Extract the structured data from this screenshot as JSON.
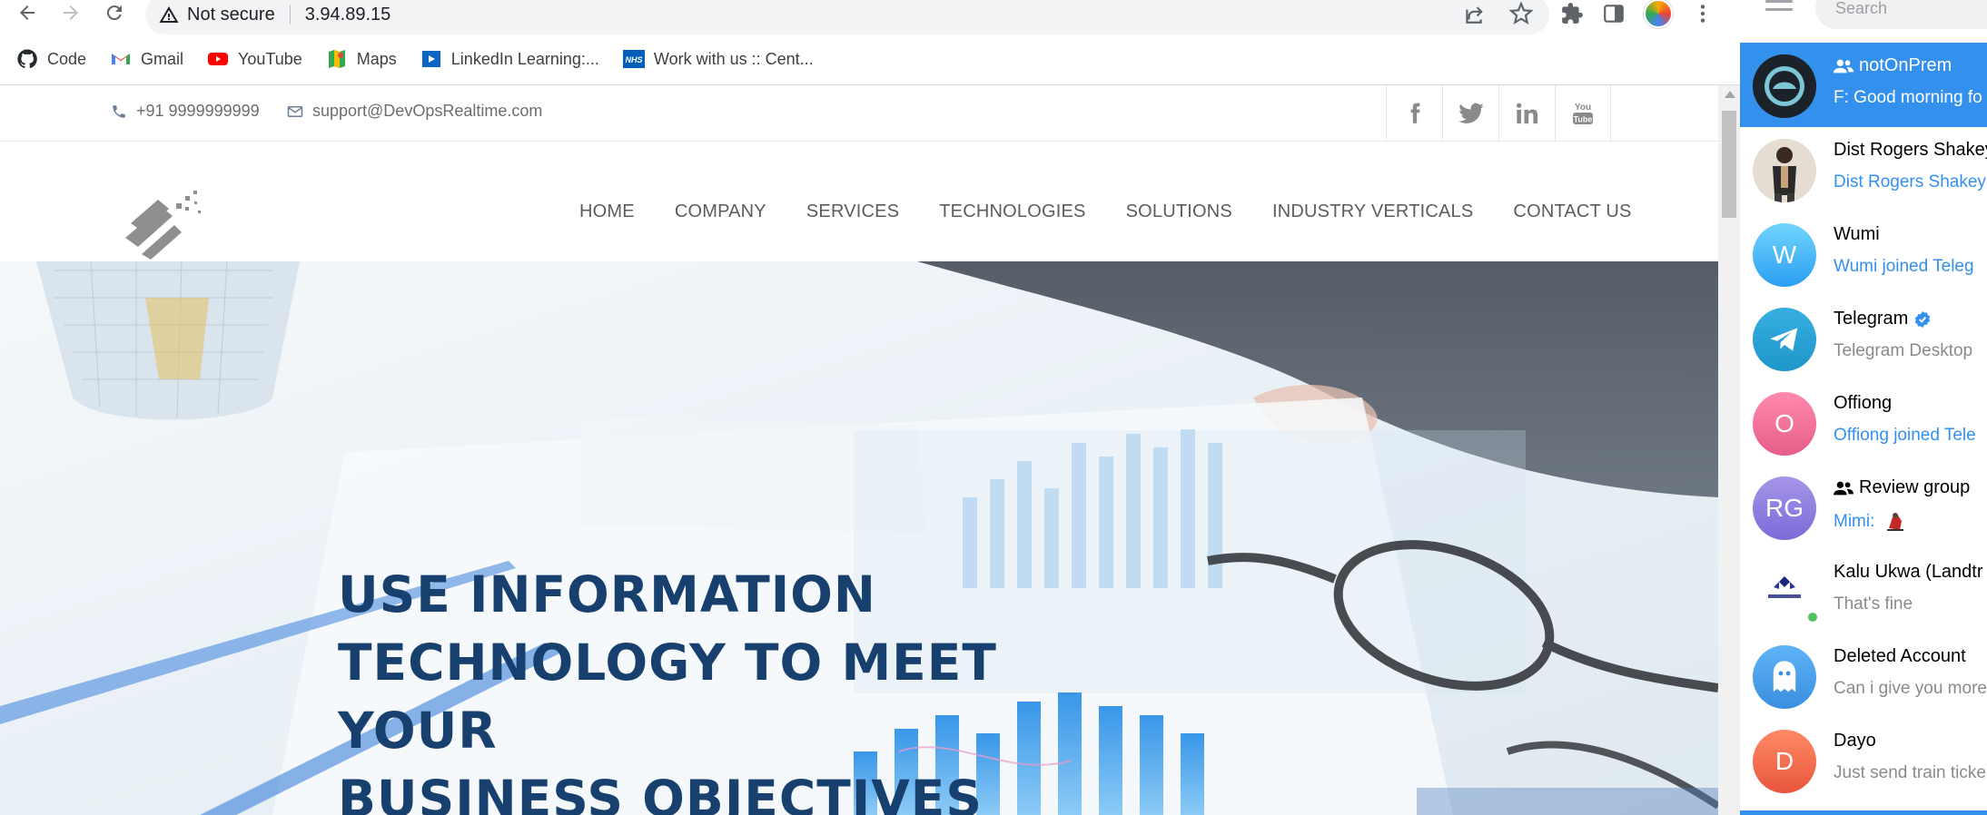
{
  "browser": {
    "omnibox": {
      "security_label": "Not secure",
      "url": "3.94.89.15"
    },
    "bookmarks": [
      {
        "label": "Code",
        "icon": "github-icon"
      },
      {
        "label": "Gmail",
        "icon": "gmail-icon"
      },
      {
        "label": "YouTube",
        "icon": "youtube-icon"
      },
      {
        "label": "Maps",
        "icon": "maps-icon"
      },
      {
        "label": "LinkedIn Learning:...",
        "icon": "linkedin-learning-icon"
      },
      {
        "label": "Work with us :: Cent...",
        "icon": "nhs-icon"
      }
    ]
  },
  "site": {
    "phone": "+91 9999999999",
    "email": "support@DevOpsRealtime.com",
    "socials": [
      "facebook",
      "twitter",
      "linkedin",
      "youtube"
    ],
    "menu": [
      "HOME",
      "COMPANY",
      "SERVICES",
      "TECHNOLOGIES",
      "SOLUTIONS",
      "INDUSTRY VERTICALS",
      "CONTACT US"
    ],
    "hero": {
      "line1": "USE INFORMATION",
      "line2": "TECHNOLOGY TO MEET YOUR",
      "line3": "BUSINESS OBJECTIVES"
    },
    "colors": {
      "hero_text": "#18406e",
      "menu_text": "#5c5c5c"
    }
  },
  "telegram": {
    "search_placeholder": "Search",
    "accent": "#3390ec",
    "chats": [
      {
        "name": "notOnPrem",
        "msg": "F: Good morning fo",
        "group": true,
        "active": true
      },
      {
        "name": "Dist Rogers Shakey",
        "msg": "Dist Rogers Shakey",
        "msg_blue": true
      },
      {
        "name": "Wumi",
        "msg": "Wumi joined Teleg",
        "msg_blue": true,
        "initial": "W"
      },
      {
        "name": "Telegram",
        "msg": "Telegram Desktop",
        "verified": true
      },
      {
        "name": "Offiong",
        "msg": "Offiong joined Tele",
        "msg_blue": true,
        "initial": "O"
      },
      {
        "name": "Review group",
        "msg": "Mimi:",
        "msg_blue": true,
        "group": true,
        "initial": "RG"
      },
      {
        "name": "Kalu Ukwa (Landtr",
        "msg": "That's fine",
        "online": true
      },
      {
        "name": "Deleted Account",
        "msg": "Can i give you more"
      },
      {
        "name": "Dayo",
        "msg": "Just send train ticke",
        "initial": "D"
      }
    ]
  }
}
